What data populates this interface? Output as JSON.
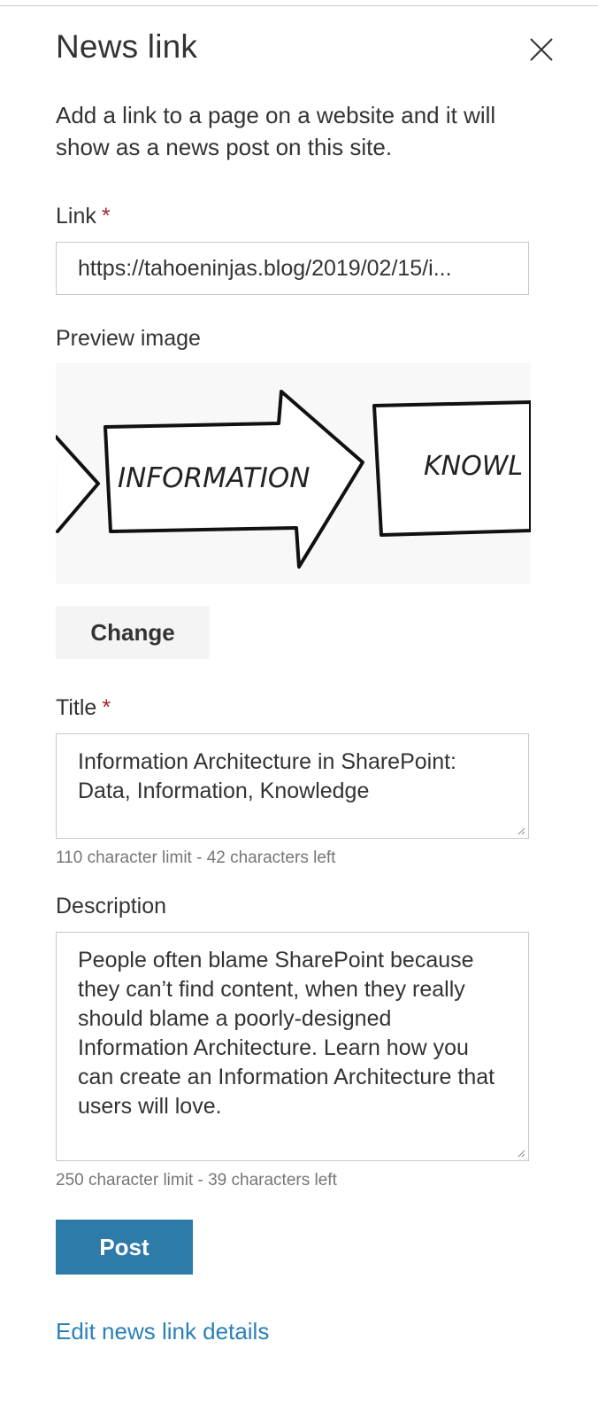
{
  "panel": {
    "title": "News link",
    "intro": "Add a link to a page on a website and it will show as a news post on this site."
  },
  "link": {
    "label": "Link",
    "required_marker": "*",
    "value": "https://tahoeninjas.blog/2019/02/15/i..."
  },
  "preview": {
    "label": "Preview image",
    "image_words": [
      "INFORMATION",
      "KNOWL"
    ],
    "change_label": "Change"
  },
  "title_field": {
    "label": "Title",
    "required_marker": "*",
    "value": "Information Architecture in SharePoint: Data, Information, Knowledge",
    "hint": "110 character limit - 42 characters left"
  },
  "description_field": {
    "label": "Description",
    "value": "People often blame SharePoint because they can’t find content, when they really should blame a poorly-designed Information Architecture. Learn how you can create an Information Architecture that users will love.",
    "hint": "250 character limit - 39 characters left"
  },
  "actions": {
    "post_label": "Post",
    "edit_link_label": "Edit news link details"
  },
  "colors": {
    "primary": "#2e7aa8",
    "link": "#2b80b9",
    "required": "#a4262c",
    "border": "#c8c8c8"
  }
}
